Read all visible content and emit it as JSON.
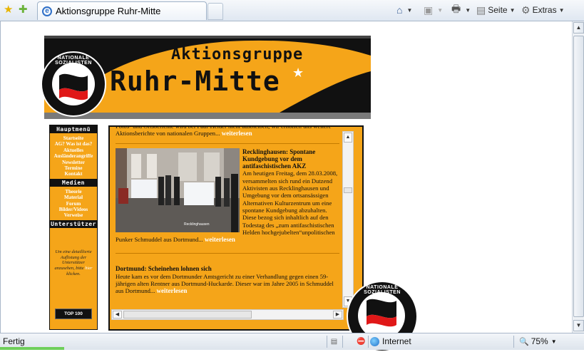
{
  "browser": {
    "tab_title": "Aktionsgruppe Ruhr-Mitte",
    "commands": {
      "page_label": "Seite",
      "tools_label": "Extras"
    },
    "icons": [
      "favorites-star-icon",
      "add-favorite-icon",
      "ie-page-icon",
      "home-icon",
      "feeds-icon",
      "print-icon",
      "page-icon",
      "gear-icon"
    ]
  },
  "site": {
    "banner": {
      "line1": "Aktionsgruppe",
      "line2": "Ruhr-Mitte",
      "badge_text": "NATIONALE SOZIALISTEN"
    },
    "sidebar": {
      "main_heading": "Hauptmenü",
      "main_items": [
        "Startseite",
        "AG? Was ist das?",
        "Aktuelles",
        "Ausländerangriffe",
        "Newsletter",
        "Termine",
        "Kontakt"
      ],
      "media_heading": "Medien",
      "media_items": [
        "Theorie",
        "Material",
        "Forum",
        "Bilder/Videos",
        "Verweise"
      ],
      "support_heading": "Unterstützer",
      "support_note_a": "Um eine detaillierte Auflistung der Unterstützer anzusehen, bitte",
      "support_note_link": "hier",
      "support_note_b": "klicken.",
      "top100_label": "TOP 100"
    },
    "content": {
      "intro_text": "Fotos- und Ortsberichte wird bei Paul-Helder nicht ausbleiben, wir erhoffen uns weitere Aktionsberichte von nationalen Gruppen...",
      "read_more": "weiterlesen",
      "article1": {
        "title": "Recklinghausen: Spontane Kundgebung vor dem antifaschistischen AKZ",
        "body": "Am heutigen Freitag, dem 28.03.2008, versammelten sich rund ein Dutzend Aktivisten aus Recklinghausen und Umgebung vor dem ortsansässigen Alternativen Kulturzentrum um eine spontane Kundgebung abzuhalten. Diese bezog sich inhaltlich auf den Todestag des „zum antifaschistischen Helden hochgejubelten“unpolitischen Punker Schmuddel aus Dortmund...",
        "photo_caption": "Recklinghausen"
      },
      "article2": {
        "title": "Dortmund: Scheinehen lohnen sich",
        "body": "Heute kam es vor dem Dortmunder Amtsgericht zu einer Verhandlung gegen einen 59-jährigen alten Rentner aus Dortmund-Huckarde. Dieser war im Jahre 2005 in Schmuddel aus Dortmund...",
        "read_more": "weiterlesen"
      }
    }
  },
  "status": {
    "text": "Fertig",
    "zone": "Internet",
    "zoom": "75%",
    "progress_percent": 11
  },
  "colors": {
    "site_orange": "#f5a519",
    "site_black": "#111111",
    "link_white": "#ffffff"
  }
}
